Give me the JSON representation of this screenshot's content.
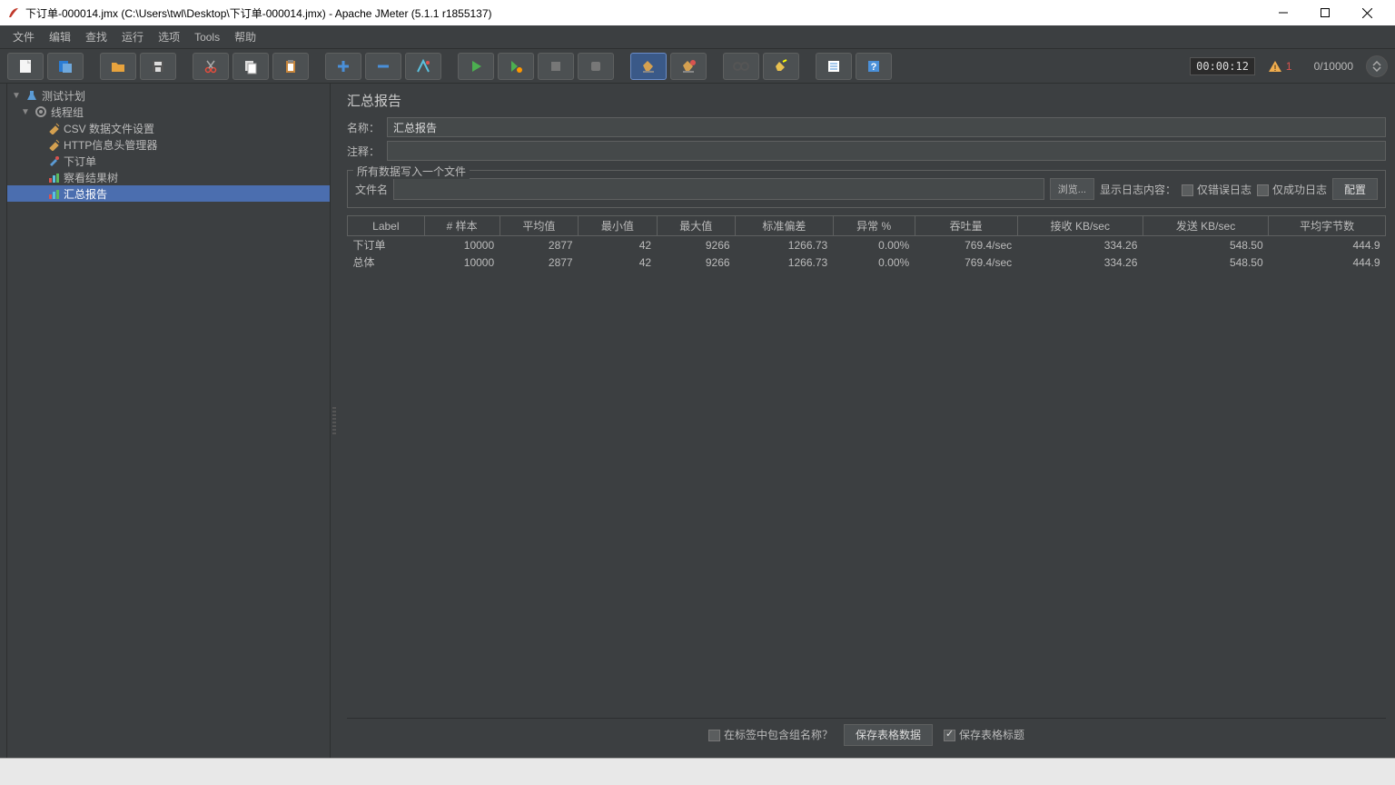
{
  "window": {
    "title": "下订单-000014.jmx (C:\\Users\\twl\\Desktop\\下订单-000014.jmx) - Apache JMeter (5.1.1 r1855137)"
  },
  "menu": {
    "file": "文件",
    "edit": "编辑",
    "search": "查找",
    "run": "运行",
    "options": "选项",
    "tools": "Tools",
    "help": "帮助"
  },
  "toolbar_status": {
    "timer": "00:00:12",
    "warn_count": "1",
    "thread_count": "0/10000"
  },
  "tree": {
    "test_plan": "测试计划",
    "thread_group": "线程组",
    "csv_config": "CSV 数据文件设置",
    "http_header": "HTTP信息头管理器",
    "sampler": "下订单",
    "results_tree": "察看结果树",
    "summary_report": "汇总报告"
  },
  "panel": {
    "title": "汇总报告",
    "name_label": "名称：",
    "name_value": "汇总报告",
    "comment_label": "注释：",
    "comment_value": "",
    "fieldset_title": "所有数据写入一个文件",
    "filename_label": "文件名",
    "browse_btn": "浏览...",
    "show_log_label": "显示日志内容：",
    "err_only": "仅错误日志",
    "succ_only": "仅成功日志",
    "config_btn": "配置"
  },
  "table": {
    "headers": [
      "Label",
      "# 样本",
      "平均值",
      "最小值",
      "最大值",
      "标准偏差",
      "异常 %",
      "吞吐量",
      "接收 KB/sec",
      "发送 KB/sec",
      "平均字节数"
    ],
    "rows": [
      {
        "label": "下订单",
        "samples": "10000",
        "avg": "2877",
        "min": "42",
        "max": "9266",
        "stddev": "1266.73",
        "error": "0.00%",
        "throughput": "769.4/sec",
        "recv": "334.26",
        "sent": "548.50",
        "avgbytes": "444.9"
      },
      {
        "label": "总体",
        "samples": "10000",
        "avg": "2877",
        "min": "42",
        "max": "9266",
        "stddev": "1266.73",
        "error": "0.00%",
        "throughput": "769.4/sec",
        "recv": "334.26",
        "sent": "548.50",
        "avgbytes": "444.9"
      }
    ]
  },
  "bottom": {
    "include_group": "在标签中包含组名称？",
    "save_data": "保存表格数据",
    "save_header": "保存表格标题"
  }
}
